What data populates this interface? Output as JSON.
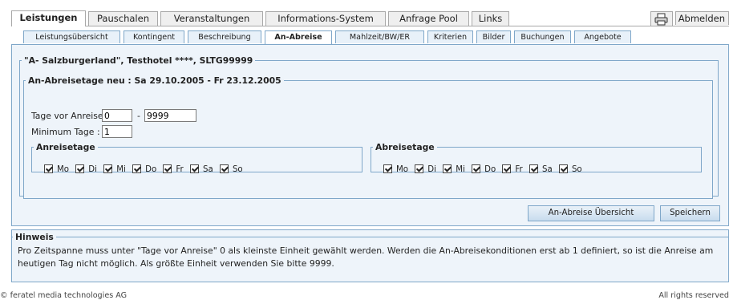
{
  "top_tabs": [
    "Leistungen",
    "Pauschalen",
    "Veranstaltungen",
    "Informations-System",
    "Anfrage Pool",
    "Links"
  ],
  "logout_label": "Abmelden",
  "print_icon": "printer-icon",
  "sub_tabs": [
    "Leistungsübersicht",
    "Kontingent",
    "Beschreibung",
    "An-Abreise",
    "Mahlzeit/BW/ER",
    "Kriterien",
    "Bilder",
    "Buchungen",
    "Angebote"
  ],
  "hotel_legend": "\"A- Salzburgerland\", Testhotel ****, SLTG99999",
  "period_legend": "An-Abreisetage neu : Sa 29.10.2005 - Fr 23.12.2005",
  "tage_vor_label": "Tage vor Anreise:",
  "tage_vor_from": "0",
  "range_sep": "-",
  "tage_vor_to": "9999",
  "min_tage_label": "Minimum Tage",
  "min_tage_colon": ":",
  "min_tage_value": "1",
  "anreise_legend": "Anreisetage",
  "abreise_legend": "Abreisetage",
  "days": [
    "Mo",
    "Di",
    "Mi",
    "Do",
    "Fr",
    "Sa",
    "So"
  ],
  "btn_overview": "An-Abreise Übersicht",
  "btn_save": "Speichern",
  "hint_legend": "Hinweis",
  "hint_text": "Pro Zeitspanne muss unter \"Tage vor Anreise\" 0 als kleinste Einheit gewählt werden. Werden die An-Abreisekonditionen erst ab 1 definiert, so ist die Anreise am heutigen Tag nicht möglich. Als größte Einheit verwenden Sie bitte 9999.",
  "footer_left": "© feratel media technologies AG",
  "footer_right": "All rights reserved"
}
